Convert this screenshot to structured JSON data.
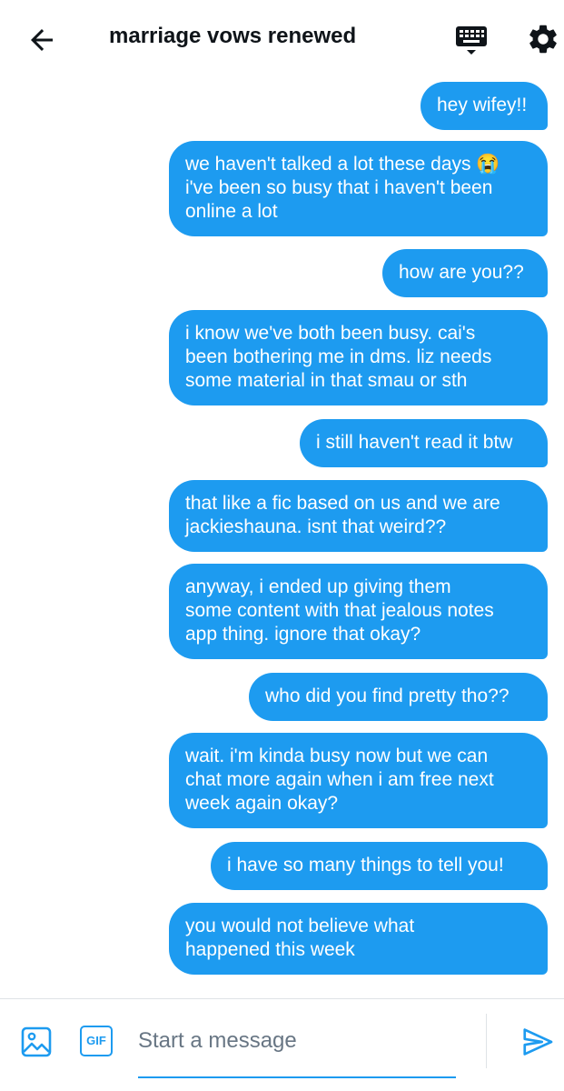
{
  "header": {
    "title": "marriage vows renewed",
    "back_icon": "arrow-left-icon",
    "keyboard_icon": "keyboard-icon",
    "settings_icon": "gear-icon"
  },
  "messages": [
    "hey wifey!!",
    "we haven't talked a lot these days 😭\ni've been so busy that i haven't been\nonline a lot",
    "how are you??",
    "i know we've both been busy. cai's\nbeen bothering me in dms. liz needs\nsome material in that smau or sth",
    "i still haven't read it btw",
    "that like a fic based on us and we are\njackieshauna. isnt that weird??",
    "anyway, i ended up giving them\nsome content with that jealous notes\napp thing. ignore that okay?",
    "who did you find pretty tho??",
    "wait. i'm kinda busy now but we can\nchat more again when i am free next\nweek again okay?",
    "i have so many things to tell you!",
    "you would not believe what\nhappened this week"
  ],
  "composer": {
    "image_icon": "image-icon",
    "gif_label": "GIF",
    "placeholder": "Start a message",
    "value": "",
    "send_icon": "send-icon"
  },
  "colors": {
    "accent": "#1d9bf0",
    "bubble_text": "#ffffff",
    "title": "#0f1419",
    "placeholder": "#687684"
  }
}
